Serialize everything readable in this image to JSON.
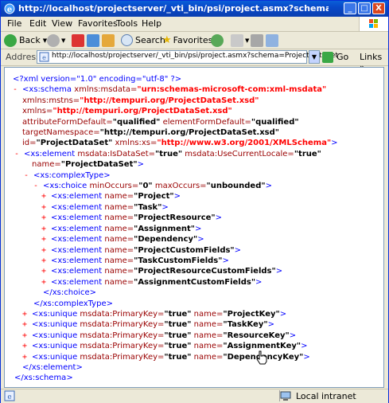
{
  "window": {
    "title": "http://localhost/projectserver/_vti_bin/psi/project.asmx?schema=ProjectDataSet - Micros...",
    "minimize": "_",
    "maximize": "□",
    "close": "X"
  },
  "menu": [
    "File",
    "Edit",
    "View",
    "Favorites",
    "Tools",
    "Help"
  ],
  "toolbar": {
    "back": "Back",
    "search": "Search",
    "favorites": "Favorites"
  },
  "address": {
    "label": "Address",
    "url": "http://localhost/projectserver/_vti_bin/psi/project.asmx?schema=ProjectDataSet",
    "go": "Go",
    "links": "Links"
  },
  "status": {
    "zone": "Local intranet"
  },
  "xml": {
    "decl": "<?xml version=\"1.0\" encoding=\"utf-8\" ?>",
    "schema_open_tag": "<xs:schema",
    "schema_xmlns_msdata_attr": "xmlns:msdata=",
    "schema_xmlns_msdata_val": "\"urn:schemas-microsoft-com:xml-msdata\"",
    "mstns_attr": "xmlns:mstns=",
    "mstns_val": "\"http://tempuri.org/ProjectDataSet.xsd\"",
    "xmlns_attr": "xmlns=",
    "xmlns_val": "\"http://tempuri.org/ProjectDataSet.xsd\"",
    "afd_attr": "attributeFormDefault=",
    "afd_val": "\"qualified\"",
    "efd_attr": "elementFormDefault=",
    "efd_val": "\"qualified\"",
    "tns_attr": "targetNamespace=",
    "tns_val": "\"http://tempuri.org/ProjectDataSet.xsd\"",
    "id_attr": "id=",
    "id_val": "\"ProjectDataSet\"",
    "xs_attr": "xmlns:xs=",
    "xs_val": "\"http://www.w3.org/2001/XMLSchema\"",
    "el_open": "<xs:element",
    "isds_attr": "msdata:IsDataSet=",
    "isds_val": "\"true\"",
    "ucl_attr": "msdata:UseCurrentLocale=",
    "ucl_val": "\"true\"",
    "name_attr": "name=",
    "name_pds_val": "\"ProjectDataSet\"",
    "complex_open": "<xs:complexType>",
    "choice_open": "<xs:choice",
    "minoccurs_attr": "minOccurs=",
    "minoccurs_val": "\"0\"",
    "maxoccurs_attr": "maxOccurs=",
    "maxoccurs_val": "\"unbounded\"",
    "elements": [
      "\"Project\"",
      "\"Task\"",
      "\"ProjectResource\"",
      "\"Assignment\"",
      "\"Dependency\"",
      "\"ProjectCustomFields\"",
      "\"TaskCustomFields\"",
      "\"ProjectResourceCustomFields\"",
      "\"AssignmentCustomFields\""
    ],
    "choice_close": "</xs:choice>",
    "complex_close": "</xs:complexType>",
    "unique_open": "<xs:unique",
    "pk_attr": "msdata:PrimaryKey=",
    "pk_val": "\"true\"",
    "keys": [
      "\"ProjectKey\"",
      "\"TaskKey\"",
      "\"ResourceKey\"",
      "\"AssignmentKey\"",
      "\"DependencyKey\""
    ],
    "element_close": "</xs:element>",
    "schema_close": "</xs:schema>",
    "gt": ">",
    "selfclose": ">"
  }
}
